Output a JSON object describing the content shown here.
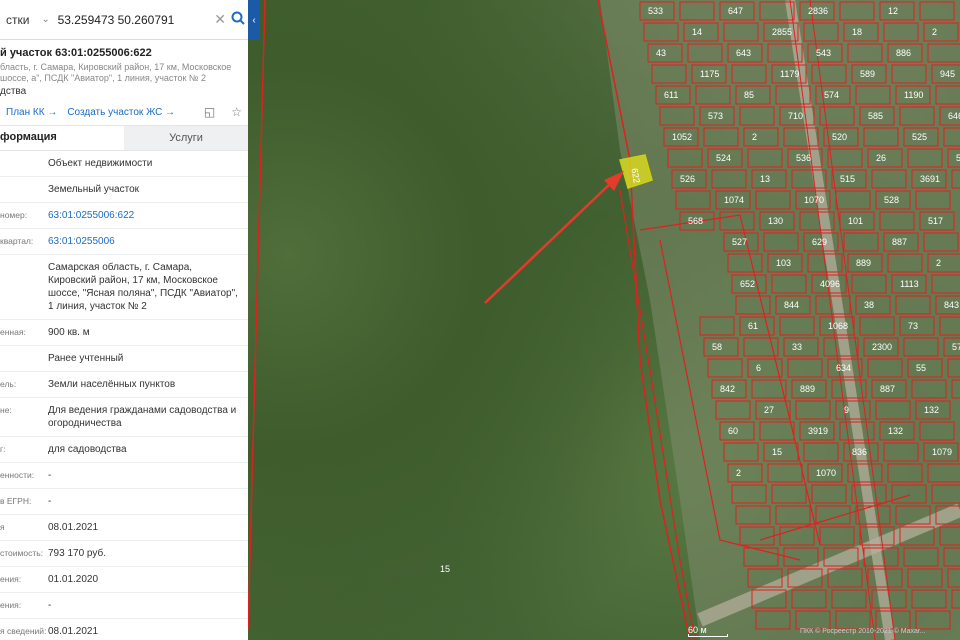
{
  "search": {
    "type_label": "стки",
    "query": "53.259473 50.260791"
  },
  "panel": {
    "title": "й участок 63:01:0255006:622",
    "address": "бласть, г. Самара, Кировский район, 17 км, Московское шоссе, а\", ПСДК \"Авиатор\", 1 линия, участок № 2",
    "type": "дства",
    "actions": {
      "plan": "План КК →",
      "create": "Создать участок ЖС →"
    },
    "tabs": [
      "формация",
      "Услуги"
    ],
    "rows": [
      {
        "label": "",
        "value": "Объект недвижимости"
      },
      {
        "label": "",
        "value": "Земельный участок"
      },
      {
        "label": "номер:",
        "value": "63:01:0255006:622"
      },
      {
        "label": "квартал:",
        "value": "63:01:0255006"
      },
      {
        "label": "",
        "value": "Самарская область, г. Самара, Кировский район, 17 км, Московское шоссе, \"Ясная поляна\", ПСДК \"Авиатор\", 1 линия, участок № 2"
      },
      {
        "label": "енная:",
        "value": "900 кв. м"
      },
      {
        "label": "",
        "value": "Ранее учтенный"
      },
      {
        "label": "ель:",
        "value": "Земли населённых пунктов"
      },
      {
        "label": "не:",
        "value": "Для ведения гражданами садоводства и огородничества"
      },
      {
        "label": "г:",
        "value": "для садоводства"
      },
      {
        "label": "енности:",
        "value": "-"
      },
      {
        "label": "в ЕГРН:",
        "value": "-"
      },
      {
        "label": "я",
        "value": "08.01.2021"
      },
      {
        "label": "стоимость:",
        "value": "793 170 руб."
      },
      {
        "label": "ения:",
        "value": "01.01.2020"
      },
      {
        "label": "ения:",
        "value": "-"
      },
      {
        "label": "я сведений:",
        "value": "08.01.2021"
      },
      {
        "label": "",
        "value": "01.01.2021"
      }
    ]
  },
  "map": {
    "scale": "60 м",
    "copyright": "ПКК © Росреестр 2010-2021 © Maxar...",
    "plot_labels": [
      "533",
      "647",
      "2836",
      "12",
      "14",
      "2855",
      "18",
      "2",
      "43",
      "643",
      "543",
      "886",
      "1175",
      "1179",
      "589",
      "945",
      "611",
      "85",
      "574",
      "1190",
      "573",
      "710",
      "585",
      "646",
      "1052",
      "2",
      "520",
      "525",
      "524",
      "536",
      "26",
      "519",
      "526",
      "13",
      "515",
      "3691",
      "1074",
      "1070",
      "528",
      "568",
      "130",
      "101",
      "517",
      "527",
      "629",
      "887",
      "103",
      "889",
      "2",
      "652",
      "4096",
      "1113",
      "844",
      "38",
      "843",
      "61",
      "1068",
      "73",
      "58",
      "33",
      "2300",
      "57",
      "6",
      "634",
      "55",
      "842",
      "889",
      "887",
      "14",
      "27",
      "9",
      "132",
      "60",
      "3919",
      "132",
      "15",
      "836",
      "1079",
      "2",
      "1070"
    ],
    "highlight_label": "622"
  }
}
